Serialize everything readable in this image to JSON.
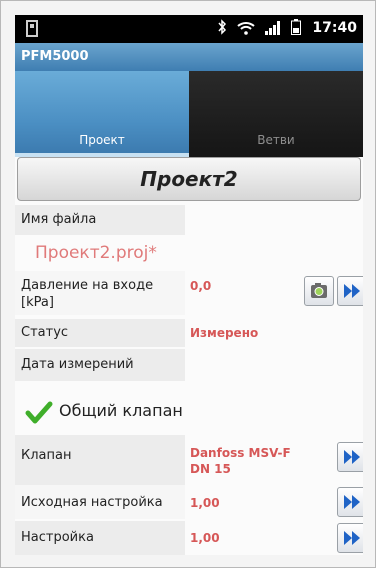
{
  "status_bar": {
    "time": "17:40"
  },
  "app": {
    "title": "PFM5000"
  },
  "tabs": [
    {
      "label": "Проект",
      "active": true
    },
    {
      "label": "Ветви",
      "active": false
    }
  ],
  "project_button": {
    "label": "Проект2"
  },
  "file": {
    "label": "Имя файла",
    "value": "Проект2.proj*"
  },
  "fields": {
    "pressure": {
      "label": "Давление на входе [kPa]",
      "value": "0,0"
    },
    "status": {
      "label": "Статус",
      "value": "Измерено"
    },
    "date": {
      "label": "Дата измерений",
      "value": ""
    }
  },
  "common_valve": {
    "label": "Общий клапан",
    "checked": true
  },
  "valve": {
    "label": "Клапан",
    "value": "Danfoss MSV-F DN 15"
  },
  "initial_setting": {
    "label": "Исходная настройка",
    "value": "1,00"
  },
  "setting": {
    "label": "Настройка",
    "value": "1,00"
  },
  "colors": {
    "accent": "#4b8fc3",
    "value_red": "#d65757",
    "check_green": "#3fae2a"
  }
}
